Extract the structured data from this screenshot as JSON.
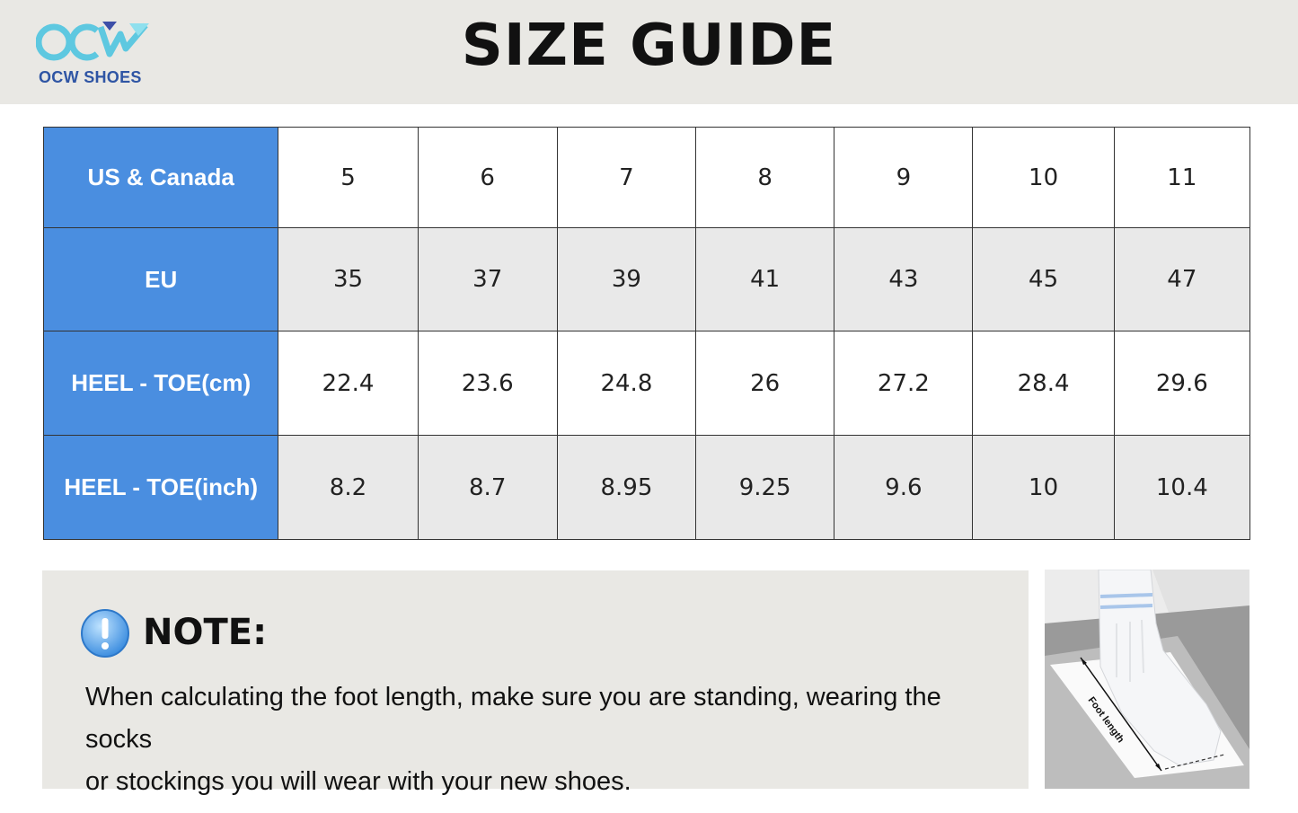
{
  "brand": {
    "name": "OCW SHOES",
    "logo_mark": "OCW"
  },
  "page": {
    "title": "SIZE GUIDE"
  },
  "size_table": {
    "rows": [
      {
        "label": "US & Canada",
        "values": [
          "5",
          "6",
          "7",
          "8",
          "9",
          "10",
          "11"
        ]
      },
      {
        "label": "EU",
        "values": [
          "35",
          "37",
          "39",
          "41",
          "43",
          "45",
          "47"
        ]
      },
      {
        "label": "HEEL - TOE(cm)",
        "values": [
          "22.4",
          "23.6",
          "24.8",
          "26",
          "27.2",
          "28.4",
          "29.6"
        ]
      },
      {
        "label": "HEEL - TOE(inch)",
        "values": [
          "8.2",
          "8.7",
          "8.95",
          "9.25",
          "9.6",
          "10",
          "10.4"
        ]
      }
    ]
  },
  "note": {
    "icon": "info-exclamation-icon",
    "title": "NOTE:",
    "body_line1": "When calculating the foot length, make sure you are standing, wearing the socks",
    "body_line2": "or stockings you will wear with your new shoes."
  },
  "photo": {
    "label": "Foot length"
  },
  "colors": {
    "header_bg": "#e9e8e4",
    "row_header_bg": "#4a8ee0",
    "brand_blue": "#2f55a4",
    "logo_cyan": "#5ec8e0",
    "alt_row_bg": "#e9e9e9"
  }
}
